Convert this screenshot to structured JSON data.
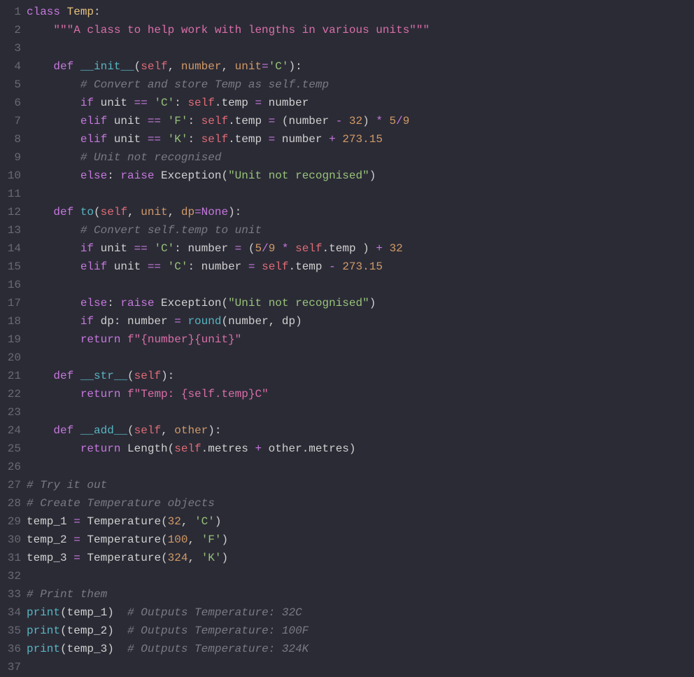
{
  "lines": [
    {
      "num": "1",
      "tokens": [
        [
          "kw",
          "class"
        ],
        [
          "id",
          " "
        ],
        [
          "name",
          "Temp"
        ],
        [
          "id",
          ":"
        ]
      ]
    },
    {
      "num": "2",
      "tokens": [
        [
          "id",
          "    "
        ],
        [
          "doc",
          "\"\"\"A class to help work with lengths in various units\"\"\""
        ]
      ]
    },
    {
      "num": "3",
      "tokens": []
    },
    {
      "num": "4",
      "tokens": [
        [
          "id",
          "    "
        ],
        [
          "kw",
          "def"
        ],
        [
          "id",
          " "
        ],
        [
          "fn",
          "__init__"
        ],
        [
          "id",
          "("
        ],
        [
          "self",
          "self"
        ],
        [
          "id",
          ", "
        ],
        [
          "param",
          "number"
        ],
        [
          "id",
          ", "
        ],
        [
          "param",
          "unit"
        ],
        [
          "op",
          "="
        ],
        [
          "str",
          "'C'"
        ],
        [
          "id",
          "):"
        ]
      ]
    },
    {
      "num": "5",
      "tokens": [
        [
          "id",
          "        "
        ],
        [
          "cmt",
          "# Convert and store Temp as self.temp"
        ]
      ]
    },
    {
      "num": "6",
      "tokens": [
        [
          "id",
          "        "
        ],
        [
          "kw",
          "if"
        ],
        [
          "id",
          " unit "
        ],
        [
          "op",
          "=="
        ],
        [
          "id",
          " "
        ],
        [
          "str",
          "'C'"
        ],
        [
          "id",
          ": "
        ],
        [
          "self",
          "self"
        ],
        [
          "id",
          ".temp "
        ],
        [
          "op",
          "="
        ],
        [
          "id",
          " number"
        ]
      ]
    },
    {
      "num": "7",
      "tokens": [
        [
          "id",
          "        "
        ],
        [
          "kw",
          "elif"
        ],
        [
          "id",
          " unit "
        ],
        [
          "op",
          "=="
        ],
        [
          "id",
          " "
        ],
        [
          "str",
          "'F'"
        ],
        [
          "id",
          ": "
        ],
        [
          "self",
          "self"
        ],
        [
          "id",
          ".temp "
        ],
        [
          "op",
          "="
        ],
        [
          "id",
          " (number "
        ],
        [
          "op",
          "-"
        ],
        [
          "id",
          " "
        ],
        [
          "num",
          "32"
        ],
        [
          "id",
          ") "
        ],
        [
          "op",
          "*"
        ],
        [
          "id",
          " "
        ],
        [
          "num",
          "5"
        ],
        [
          "op",
          "/"
        ],
        [
          "num",
          "9"
        ]
      ]
    },
    {
      "num": "8",
      "tokens": [
        [
          "id",
          "        "
        ],
        [
          "kw",
          "elif"
        ],
        [
          "id",
          " unit "
        ],
        [
          "op",
          "=="
        ],
        [
          "id",
          " "
        ],
        [
          "str",
          "'K'"
        ],
        [
          "id",
          ": "
        ],
        [
          "self",
          "self"
        ],
        [
          "id",
          ".temp "
        ],
        [
          "op",
          "="
        ],
        [
          "id",
          " number "
        ],
        [
          "op",
          "+"
        ],
        [
          "id",
          " "
        ],
        [
          "num",
          "273.15"
        ]
      ]
    },
    {
      "num": "9",
      "tokens": [
        [
          "id",
          "        "
        ],
        [
          "cmt",
          "# Unit not recognised"
        ]
      ]
    },
    {
      "num": "10",
      "tokens": [
        [
          "id",
          "        "
        ],
        [
          "kw",
          "else"
        ],
        [
          "id",
          ": "
        ],
        [
          "kw",
          "raise"
        ],
        [
          "id",
          " "
        ],
        [
          "call",
          "Exception"
        ],
        [
          "id",
          "("
        ],
        [
          "str",
          "\"Unit not recognised\""
        ],
        [
          "id",
          ")"
        ]
      ]
    },
    {
      "num": "11",
      "tokens": []
    },
    {
      "num": "12",
      "tokens": [
        [
          "id",
          "    "
        ],
        [
          "kw",
          "def"
        ],
        [
          "id",
          " "
        ],
        [
          "fn",
          "to"
        ],
        [
          "id",
          "("
        ],
        [
          "self",
          "self"
        ],
        [
          "id",
          ", "
        ],
        [
          "param",
          "unit"
        ],
        [
          "id",
          ", "
        ],
        [
          "param",
          "dp"
        ],
        [
          "op",
          "="
        ],
        [
          "kw",
          "None"
        ],
        [
          "id",
          "):"
        ]
      ]
    },
    {
      "num": "13",
      "tokens": [
        [
          "id",
          "        "
        ],
        [
          "cmt",
          "# Convert self.temp to unit"
        ]
      ]
    },
    {
      "num": "14",
      "tokens": [
        [
          "id",
          "        "
        ],
        [
          "kw",
          "if"
        ],
        [
          "id",
          " unit "
        ],
        [
          "op",
          "=="
        ],
        [
          "id",
          " "
        ],
        [
          "str",
          "'C'"
        ],
        [
          "id",
          ": number "
        ],
        [
          "op",
          "="
        ],
        [
          "id",
          " ("
        ],
        [
          "num",
          "5"
        ],
        [
          "op",
          "/"
        ],
        [
          "num",
          "9"
        ],
        [
          "id",
          " "
        ],
        [
          "op",
          "*"
        ],
        [
          "id",
          " "
        ],
        [
          "self",
          "self"
        ],
        [
          "id",
          ".temp ) "
        ],
        [
          "op",
          "+"
        ],
        [
          "id",
          " "
        ],
        [
          "num",
          "32"
        ]
      ]
    },
    {
      "num": "15",
      "tokens": [
        [
          "id",
          "        "
        ],
        [
          "kw",
          "elif"
        ],
        [
          "id",
          " unit "
        ],
        [
          "op",
          "=="
        ],
        [
          "id",
          " "
        ],
        [
          "str",
          "'C'"
        ],
        [
          "id",
          ": number "
        ],
        [
          "op",
          "="
        ],
        [
          "id",
          " "
        ],
        [
          "self",
          "self"
        ],
        [
          "id",
          ".temp "
        ],
        [
          "op",
          "-"
        ],
        [
          "id",
          " "
        ],
        [
          "num",
          "273.15"
        ]
      ]
    },
    {
      "num": "16",
      "tokens": []
    },
    {
      "num": "17",
      "tokens": [
        [
          "id",
          "        "
        ],
        [
          "kw",
          "else"
        ],
        [
          "id",
          ": "
        ],
        [
          "kw",
          "raise"
        ],
        [
          "id",
          " "
        ],
        [
          "call",
          "Exception"
        ],
        [
          "id",
          "("
        ],
        [
          "str",
          "\"Unit not recognised\""
        ],
        [
          "id",
          ")"
        ]
      ]
    },
    {
      "num": "18",
      "tokens": [
        [
          "id",
          "        "
        ],
        [
          "kw",
          "if"
        ],
        [
          "id",
          " dp: number "
        ],
        [
          "op",
          "="
        ],
        [
          "id",
          " "
        ],
        [
          "fn",
          "round"
        ],
        [
          "id",
          "(number, dp)"
        ]
      ]
    },
    {
      "num": "19",
      "tokens": [
        [
          "id",
          "        "
        ],
        [
          "kw",
          "return"
        ],
        [
          "id",
          " "
        ],
        [
          "doc",
          "f\"{number}{unit}\""
        ]
      ]
    },
    {
      "num": "20",
      "tokens": []
    },
    {
      "num": "21",
      "tokens": [
        [
          "id",
          "    "
        ],
        [
          "kw",
          "def"
        ],
        [
          "id",
          " "
        ],
        [
          "fn",
          "__str__"
        ],
        [
          "id",
          "("
        ],
        [
          "self",
          "self"
        ],
        [
          "id",
          "):"
        ]
      ]
    },
    {
      "num": "22",
      "tokens": [
        [
          "id",
          "        "
        ],
        [
          "kw",
          "return"
        ],
        [
          "id",
          " "
        ],
        [
          "doc",
          "f\"Temp: {self.temp}C\""
        ]
      ]
    },
    {
      "num": "23",
      "tokens": []
    },
    {
      "num": "24",
      "tokens": [
        [
          "id",
          "    "
        ],
        [
          "kw",
          "def"
        ],
        [
          "id",
          " "
        ],
        [
          "fn",
          "__add__"
        ],
        [
          "id",
          "("
        ],
        [
          "self",
          "self"
        ],
        [
          "id",
          ", "
        ],
        [
          "param",
          "other"
        ],
        [
          "id",
          "):"
        ]
      ]
    },
    {
      "num": "25",
      "tokens": [
        [
          "id",
          "        "
        ],
        [
          "kw",
          "return"
        ],
        [
          "id",
          " "
        ],
        [
          "call",
          "Length"
        ],
        [
          "id",
          "("
        ],
        [
          "self",
          "self"
        ],
        [
          "id",
          ".metres "
        ],
        [
          "op",
          "+"
        ],
        [
          "id",
          " other.metres)"
        ]
      ]
    },
    {
      "num": "26",
      "tokens": []
    },
    {
      "num": "27",
      "tokens": [
        [
          "cmt",
          "# Try it out"
        ]
      ]
    },
    {
      "num": "28",
      "tokens": [
        [
          "cmt",
          "# Create Temperature objects"
        ]
      ]
    },
    {
      "num": "29",
      "tokens": [
        [
          "id",
          "temp_1 "
        ],
        [
          "op",
          "="
        ],
        [
          "id",
          " "
        ],
        [
          "call",
          "Temperature"
        ],
        [
          "id",
          "("
        ],
        [
          "num",
          "32"
        ],
        [
          "id",
          ", "
        ],
        [
          "str",
          "'C'"
        ],
        [
          "id",
          ")"
        ]
      ]
    },
    {
      "num": "30",
      "tokens": [
        [
          "id",
          "temp_2 "
        ],
        [
          "op",
          "="
        ],
        [
          "id",
          " "
        ],
        [
          "call",
          "Temperature"
        ],
        [
          "id",
          "("
        ],
        [
          "num",
          "100"
        ],
        [
          "id",
          ", "
        ],
        [
          "str",
          "'F'"
        ],
        [
          "id",
          ")"
        ]
      ]
    },
    {
      "num": "31",
      "tokens": [
        [
          "id",
          "temp_3 "
        ],
        [
          "op",
          "="
        ],
        [
          "id",
          " "
        ],
        [
          "call",
          "Temperature"
        ],
        [
          "id",
          "("
        ],
        [
          "num",
          "324"
        ],
        [
          "id",
          ", "
        ],
        [
          "str",
          "'K'"
        ],
        [
          "id",
          ")"
        ]
      ]
    },
    {
      "num": "32",
      "tokens": []
    },
    {
      "num": "33",
      "tokens": [
        [
          "cmt",
          "# Print them"
        ]
      ]
    },
    {
      "num": "34",
      "tokens": [
        [
          "fn",
          "print"
        ],
        [
          "id",
          "(temp_1)  "
        ],
        [
          "cmt",
          "# Outputs Temperature: 32C"
        ]
      ]
    },
    {
      "num": "35",
      "tokens": [
        [
          "fn",
          "print"
        ],
        [
          "id",
          "(temp_2)  "
        ],
        [
          "cmt",
          "# Outputs Temperature: 100F"
        ]
      ]
    },
    {
      "num": "36",
      "tokens": [
        [
          "fn",
          "print"
        ],
        [
          "id",
          "(temp_3)  "
        ],
        [
          "cmt",
          "# Outputs Temperature: 324K"
        ]
      ]
    },
    {
      "num": "37",
      "tokens": []
    }
  ]
}
